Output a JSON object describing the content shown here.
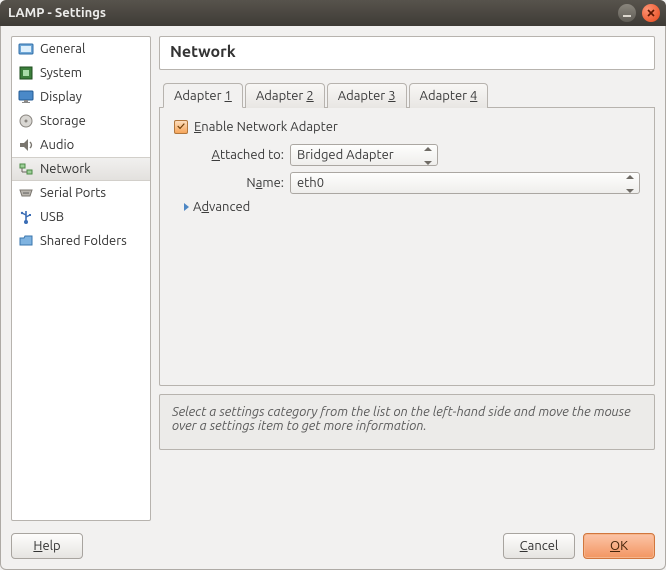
{
  "window": {
    "title": "LAMP - Settings"
  },
  "sidebar": {
    "items": [
      {
        "label": "General",
        "icon": "general-icon",
        "selected": false
      },
      {
        "label": "System",
        "icon": "system-icon",
        "selected": false
      },
      {
        "label": "Display",
        "icon": "display-icon",
        "selected": false
      },
      {
        "label": "Storage",
        "icon": "storage-icon",
        "selected": false
      },
      {
        "label": "Audio",
        "icon": "audio-icon",
        "selected": false
      },
      {
        "label": "Network",
        "icon": "network-icon",
        "selected": true
      },
      {
        "label": "Serial Ports",
        "icon": "serial-ports-icon",
        "selected": false
      },
      {
        "label": "USB",
        "icon": "usb-icon",
        "selected": false
      },
      {
        "label": "Shared Folders",
        "icon": "shared-folders-icon",
        "selected": false
      }
    ]
  },
  "main": {
    "heading": "Network",
    "tabs": [
      {
        "prefix": "Adapter ",
        "key": "1",
        "active": true
      },
      {
        "prefix": "Adapter ",
        "key": "2",
        "active": false
      },
      {
        "prefix": "Adapter ",
        "key": "3",
        "active": false
      },
      {
        "prefix": "Adapter ",
        "key": "4",
        "active": false
      }
    ],
    "enable_label_prefix": "",
    "enable_label_ul": "E",
    "enable_label_rest": "nable Network Adapter",
    "enable_checked": true,
    "attached_label_prefix": "",
    "attached_label_ul": "A",
    "attached_label_rest": "ttached to:",
    "attached_value": "Bridged Adapter",
    "name_label_prefix": "N",
    "name_label_ul": "a",
    "name_label_rest": "me:",
    "name_value": "eth0",
    "advanced_label_prefix": "A",
    "advanced_label_ul": "d",
    "advanced_label_rest": "vanced"
  },
  "help_text": "Select a settings category from the list on the left-hand side and move the mouse over a settings item to get more information.",
  "footer": {
    "help_ul": "H",
    "help_rest": "elp",
    "cancel_ul": "C",
    "cancel_rest": "ancel",
    "ok_ul": "O",
    "ok_rest": "K"
  }
}
